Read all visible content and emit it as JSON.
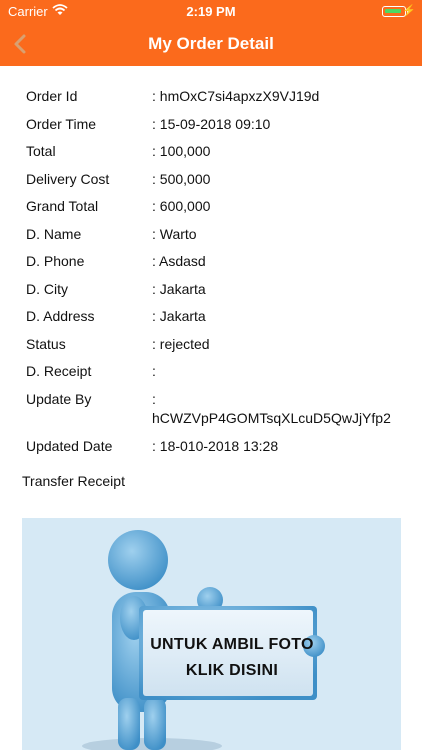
{
  "statusbar": {
    "carrier": "Carrier",
    "time": "2:19 PM"
  },
  "header": {
    "title": "My Order Detail",
    "back_icon": "chevron-left-icon"
  },
  "order": {
    "rows": [
      {
        "label": "Order Id",
        "value": ": hmOxC7si4apxzX9VJ19d"
      },
      {
        "label": "Order Time",
        "value": ": 15-09-2018 09:10"
      },
      {
        "label": "Total",
        "value": ": 100,000"
      },
      {
        "label": "Delivery Cost",
        "value": ": 500,000"
      },
      {
        "label": "Grand Total",
        "value": ": 600,000"
      },
      {
        "label": "D. Name",
        "value": ": Warto"
      },
      {
        "label": "D. Phone",
        "value": ": Asdasd"
      },
      {
        "label": "D. City",
        "value": ": Jakarta"
      },
      {
        "label": "D. Address",
        "value": ": Jakarta"
      },
      {
        "label": "Status",
        "value": ": rejected"
      },
      {
        "label": "D. Receipt",
        "value": ":"
      },
      {
        "label": "Update By",
        "value_line1": ":",
        "value_line2": "hCWZVpP4GOMTsqXLcuD5QwJjYfp2"
      },
      {
        "label": "Updated Date",
        "value": ": 18-010-2018 13:28"
      }
    ]
  },
  "transfer_receipt": {
    "label": "Transfer Receipt",
    "image_line1": "UNTUK AMBIL FOTO",
    "image_line2": "KLIK DISINI"
  },
  "colors": {
    "accent": "#fb6a1c",
    "image_bg": "#d6e9f5"
  }
}
